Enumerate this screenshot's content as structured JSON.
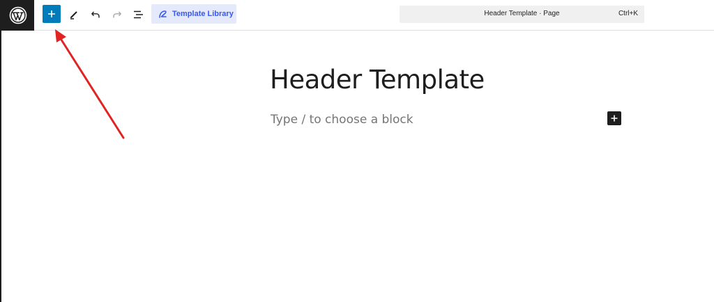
{
  "toolbar": {
    "template_library_label": "Template Library"
  },
  "command_bar": {
    "title": "Header Template · Page",
    "shortcut": "Ctrl+K"
  },
  "editor": {
    "page_title": "Header Template",
    "block_placeholder": "Type / to choose a block"
  },
  "icons": {
    "logo": "wordpress-logo-icon",
    "add": "plus-icon",
    "tools": "pencil-icon",
    "undo": "undo-icon",
    "redo": "redo-icon",
    "outline": "document-overview-icon",
    "template_library": "template-library-icon",
    "inline_add": "plus-icon"
  },
  "colors": {
    "accent": "#007cba",
    "template_library_bg": "#e4eafc",
    "template_library_text": "#3858e9",
    "annotation_arrow": "#e02424",
    "dark": "#1e1e1e"
  }
}
